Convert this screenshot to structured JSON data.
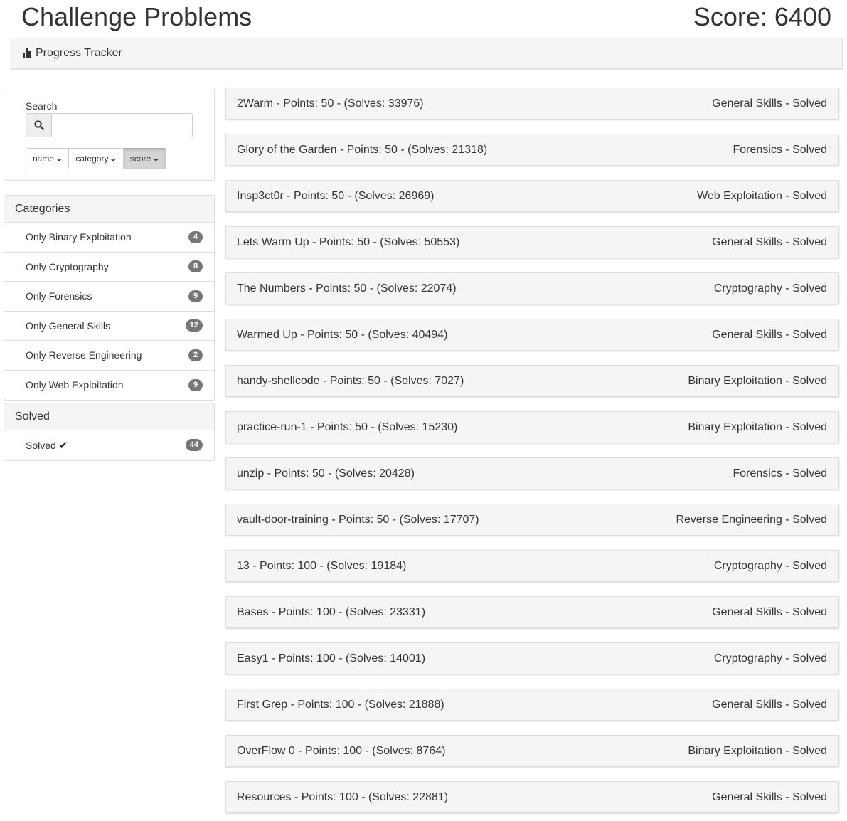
{
  "header": {
    "title": "Challenge Problems",
    "score": "Score: 6400",
    "tracker_label": "Progress Tracker"
  },
  "search": {
    "label": "Search",
    "value": "",
    "placeholder": "",
    "sort_buttons": [
      "name",
      "category",
      "score"
    ],
    "active_sort": "score"
  },
  "categories": {
    "heading": "Categories",
    "items": [
      {
        "label": "Only Binary Exploitation",
        "count": "4"
      },
      {
        "label": "Only Cryptography",
        "count": "8"
      },
      {
        "label": "Only Forensics",
        "count": "9"
      },
      {
        "label": "Only General Skills",
        "count": "12"
      },
      {
        "label": "Only Reverse Engineering",
        "count": "2"
      },
      {
        "label": "Only Web Exploitation",
        "count": "9"
      }
    ]
  },
  "solved": {
    "heading": "Solved",
    "item_label": "Solved",
    "count": "44"
  },
  "problems": [
    {
      "title": "2Warm - Points: 50 - (Solves: 33976)",
      "status": "General Skills - Solved"
    },
    {
      "title": "Glory of the Garden - Points: 50 - (Solves: 21318)",
      "status": "Forensics - Solved"
    },
    {
      "title": "Insp3ct0r - Points: 50 - (Solves: 26969)",
      "status": "Web Exploitation - Solved"
    },
    {
      "title": "Lets Warm Up - Points: 50 - (Solves: 50553)",
      "status": "General Skills - Solved"
    },
    {
      "title": "The Numbers - Points: 50 - (Solves: 22074)",
      "status": "Cryptography - Solved"
    },
    {
      "title": "Warmed Up - Points: 50 - (Solves: 40494)",
      "status": "General Skills - Solved"
    },
    {
      "title": "handy-shellcode - Points: 50 - (Solves: 7027)",
      "status": "Binary Exploitation - Solved"
    },
    {
      "title": "practice-run-1 - Points: 50 - (Solves: 15230)",
      "status": "Binary Exploitation - Solved"
    },
    {
      "title": "unzip - Points: 50 - (Solves: 20428)",
      "status": "Forensics - Solved"
    },
    {
      "title": "vault-door-training - Points: 50 - (Solves: 17707)",
      "status": "Reverse Engineering - Solved"
    },
    {
      "title": "13 - Points: 100 - (Solves: 19184)",
      "status": "Cryptography - Solved"
    },
    {
      "title": "Bases - Points: 100 - (Solves: 23331)",
      "status": "General Skills - Solved"
    },
    {
      "title": "Easy1 - Points: 100 - (Solves: 14001)",
      "status": "Cryptography - Solved"
    },
    {
      "title": "First Grep - Points: 100 - (Solves: 21888)",
      "status": "General Skills - Solved"
    },
    {
      "title": "OverFlow 0 - Points: 100 - (Solves: 8764)",
      "status": "Binary Exploitation - Solved"
    },
    {
      "title": "Resources - Points: 100 - (Solves: 22881)",
      "status": "General Skills - Solved"
    }
  ],
  "icons": {
    "tracker": "bar-chart-icon",
    "search": "search-icon",
    "sort": "chevron-down-icon",
    "solved": "check-icon"
  }
}
